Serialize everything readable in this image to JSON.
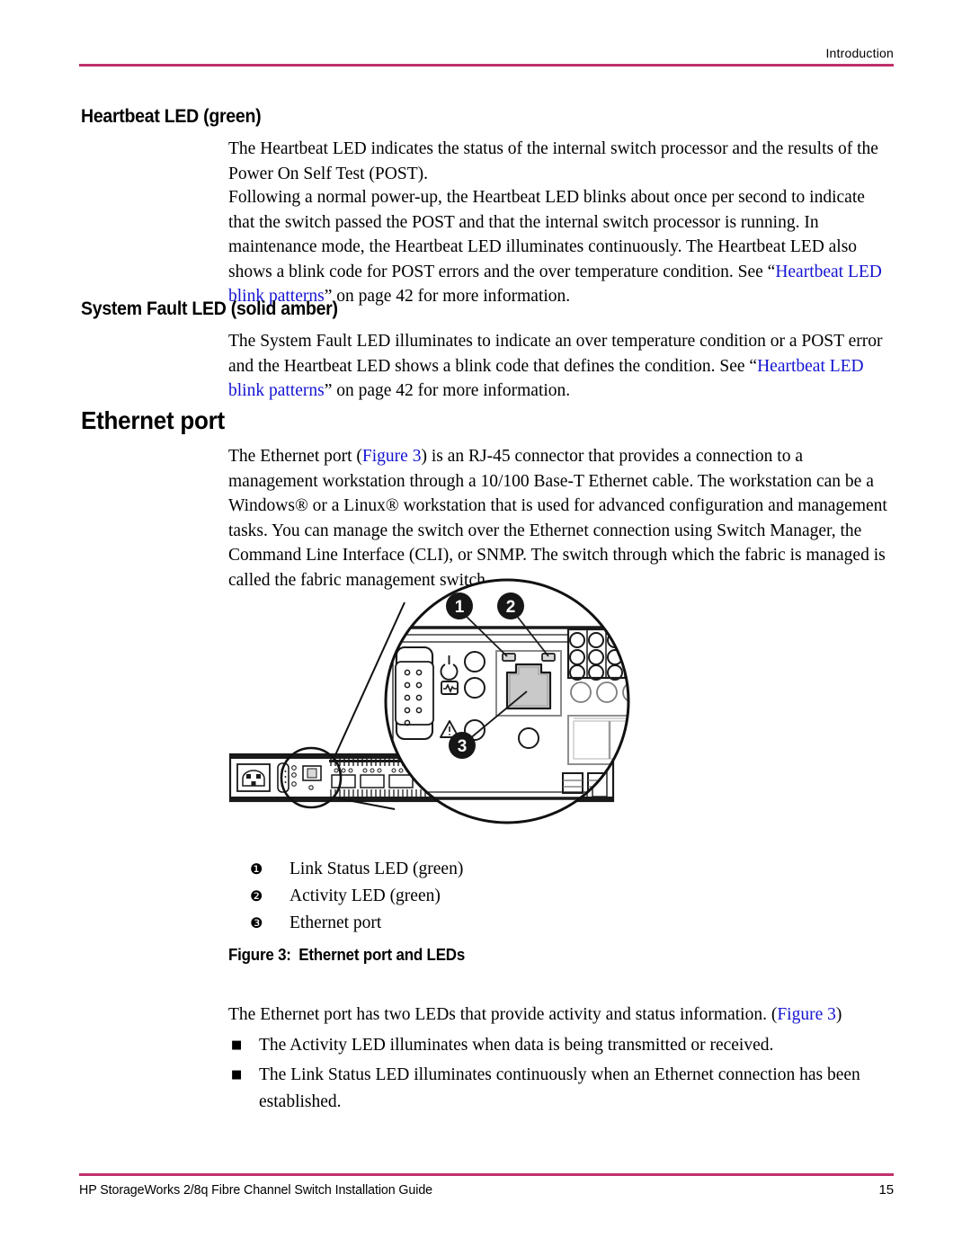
{
  "page": {
    "running_head": "Introduction",
    "rule_color": "#c0306b",
    "link_color": "#1414d2",
    "page_number": "15",
    "footer_title": "HP StorageWorks 2/8q Fibre Channel Switch Installation Guide"
  },
  "sections": [
    {
      "id": "heartbeat-led",
      "heading": "Heartbeat LED (green)",
      "level": "h2",
      "paragraphs": [
        {
          "id": "heartbeat-p1",
          "runs": [
            {
              "text": "The Heartbeat LED indicates the status of the internal switch processor and the results of the Power On Self Test (POST).",
              "link": false
            }
          ]
        },
        {
          "id": "heartbeat-p2",
          "runs": [
            {
              "text": "Following a normal power-up, the Heartbeat LED blinks about once per second to indicate that the switch passed the POST and that the internal switch processor is running. In maintenance mode, the Heartbeat LED illuminates continuously. The Heartbeat LED also shows a blink code for POST errors and the over temperature condition. See “",
              "link": false
            },
            {
              "text": "Heartbeat LED blink patterns",
              "link": true
            },
            {
              "text": "” on page 42 for more information.",
              "link": false
            }
          ]
        }
      ]
    },
    {
      "id": "system-fault-led",
      "heading": "System Fault LED (solid amber)",
      "level": "h2",
      "paragraphs": [
        {
          "id": "fault-p1",
          "runs": [
            {
              "text": "The System Fault LED illuminates to indicate an over temperature condition or a POST error and the Heartbeat LED shows a blink code that defines the condition. See “",
              "link": false
            },
            {
              "text": "Heartbeat LED blink patterns",
              "link": true
            },
            {
              "text": "” on page 42 for more information.",
              "link": false
            }
          ]
        }
      ]
    },
    {
      "id": "ethernet-port",
      "heading": "Ethernet port",
      "level": "h1",
      "paragraphs": [
        {
          "id": "ethernet-p1",
          "runs": [
            {
              "text": "The Ethernet port (",
              "link": false
            },
            {
              "text": "Figure 3",
              "link": true
            },
            {
              "text": ") is an RJ-45 connector that provides a connection to a management workstation through a 10/100 Base-T Ethernet cable. The workstation can be a Windows® or a Linux® workstation that is used for advanced configuration and management tasks. You can manage the switch over the Ethernet connection using Switch Manager, the Command Line Interface (CLI), or SNMP. The switch through which the fabric is managed is called the fabric management switch.",
              "link": false
            }
          ]
        }
      ]
    }
  ],
  "figure": {
    "id": "figure-3",
    "caption_number": "Figure 3:",
    "caption_text": "Ethernet port and LEDs",
    "description": "Line drawing of switch rear panel with a magnified circular callout showing the RJ-45 Ethernet port and its two LEDs",
    "callouts": [
      {
        "number": "1",
        "marker": "❶",
        "label": "Link Status LED (green)"
      },
      {
        "number": "2",
        "marker": "❷",
        "label": "Activity LED (green)"
      },
      {
        "number": "3",
        "marker": "❸",
        "label": "Ethernet port"
      }
    ]
  },
  "trailing": {
    "intro": {
      "id": "trailing-intro",
      "runs": [
        {
          "text": "The Ethernet port has two LEDs that provide activity and status information. (",
          "link": false
        },
        {
          "text": "Figure 3",
          "link": true
        },
        {
          "text": ")",
          "link": false
        }
      ]
    },
    "bullet_mark": "■",
    "bullets": [
      "The Activity LED illuminates when data is being transmitted or received.",
      "The Link Status LED illuminates continuously when an Ethernet connection has been established."
    ]
  }
}
